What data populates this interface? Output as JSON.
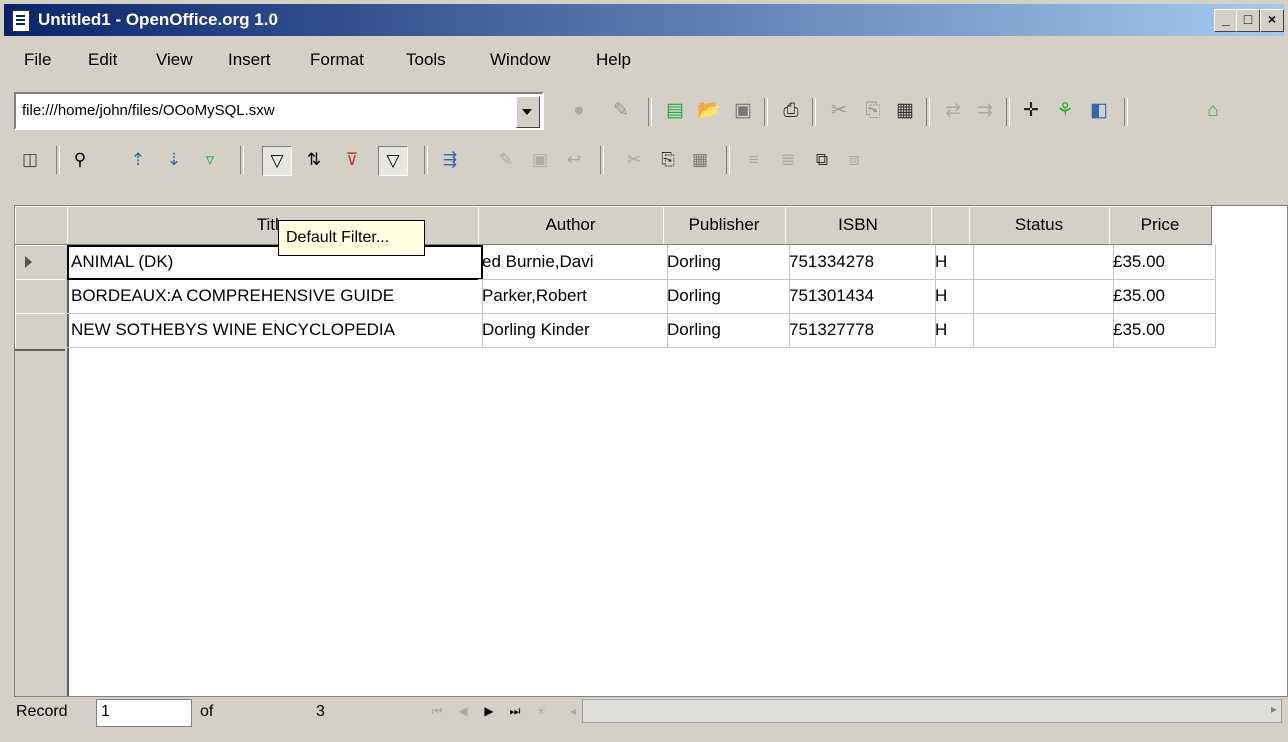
{
  "window": {
    "title": "Untitled1 - OpenOffice.org 1.0"
  },
  "menu": [
    "File",
    "Edit",
    "View",
    "Insert",
    "Format",
    "Tools",
    "Window",
    "Help"
  ],
  "function_bar": {
    "url_value": "file:///home/john/files/OOoMySQL.sxw"
  },
  "tooltip": "Default Filter...",
  "table": {
    "columns": [
      "Title",
      "Author",
      "Publisher",
      "ISBN",
      "",
      "Status",
      "Price"
    ],
    "rows": [
      [
        "ANIMAL (DK)",
        "ed Burnie,Davi",
        "Dorling",
        "751334278",
        "H",
        "",
        "£35.00"
      ],
      [
        "BORDEAUX:A COMPREHENSIVE GUIDE",
        "Parker,Robert",
        "Dorling",
        "751301434",
        "H",
        "",
        "£35.00"
      ],
      [
        "NEW SOTHEBYS WINE ENCYCLOPEDIA",
        "Dorling Kinder",
        "Dorling",
        "751327778",
        "H",
        "",
        "£35.00"
      ]
    ]
  },
  "record_bar": {
    "label": "Record",
    "current": "1",
    "of_label": "of",
    "total": "3"
  }
}
